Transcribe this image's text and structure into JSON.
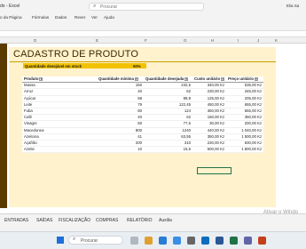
{
  "window": {
    "title": "do - Excel",
    "user": "Elia Sa"
  },
  "search": {
    "placeholder": "Procurar"
  },
  "ribbon": {
    "tabs": [
      "o da Página",
      "Fórmulas",
      "Dados",
      "Rever",
      "Ver",
      "Ajuda"
    ]
  },
  "columns": [
    "D",
    "E",
    "F",
    "G",
    "H",
    "I",
    "J",
    "K"
  ],
  "sheet": {
    "title": "CADASTRO DE PRODUTO",
    "stock_label": "Quantidade desejável em stock",
    "stock_value": "50%",
    "headers": [
      "Produto",
      "Quantidade mínima",
      "Quantidade desejada",
      "Custo unitário",
      "Preço unitário"
    ],
    "rows": [
      [
        "Massa",
        "150",
        "232,5",
        "340,00 Kz",
        "535,00 Kz"
      ],
      [
        "Arroz",
        "40",
        "62",
        "230,00 Kz",
        "345,00 Kz"
      ],
      [
        "Açúcar",
        "58",
        "89,9",
        "125,00 Kz",
        "205,00 Kz"
      ],
      [
        "Leite",
        "79",
        "122,45",
        "450,00 Kz",
        "655,00 Kz"
      ],
      [
        "Fuba",
        "80",
        "124",
        "360,00 Kz",
        "655,00 Kz"
      ],
      [
        "Café",
        "40",
        "62",
        "150,00 Kz",
        "350,00 Kz"
      ],
      [
        "Vinagre",
        "50",
        "77,5",
        "30,00 Kz",
        "200,00 Kz"
      ],
      [
        "Macedonea",
        "800",
        "1240",
        "440,00 Kz",
        "1 040,00 Kz"
      ],
      [
        "Azeitona",
        "41",
        "63,55",
        "350,00 Kz",
        "1 500,00 Kz"
      ],
      [
        "Açafrão",
        "200",
        "310",
        "230,00 Kz",
        "830,00 Kz"
      ],
      [
        "Azeite",
        "10",
        "15,5",
        "500,00 Kz",
        "1 800,00 Kz"
      ]
    ]
  },
  "sheet_tabs": [
    "ENTRADAS",
    "SAÍDAS",
    "FISCALIZAÇÃO",
    "COMPRAS",
    "RELATÓRIO",
    "Auxilia"
  ],
  "watermark": "Ativar o Windo",
  "taskbar": {
    "search_placeholder": "Procurar"
  },
  "colors": {
    "accent": "#217346",
    "sheet_bg": "#fff2cc",
    "stock_bar": "#f2c200",
    "side_bar": "#5b3a00"
  },
  "icons": [
    "search-icon",
    "windows-start-icon",
    "dropdown-arrow-icon"
  ]
}
